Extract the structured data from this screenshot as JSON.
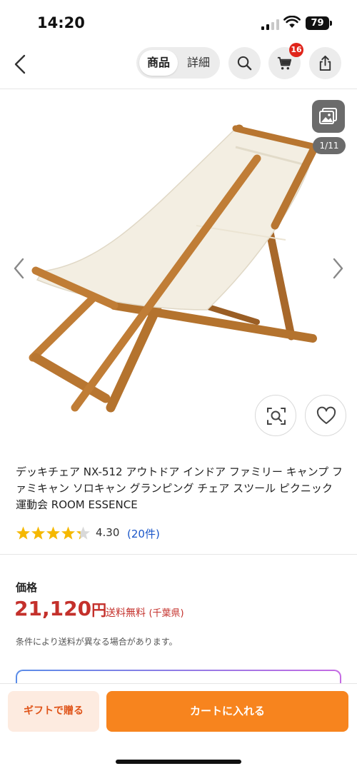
{
  "status_bar": {
    "time": "14:20",
    "battery": "79"
  },
  "nav": {
    "tab_product": "商品",
    "tab_detail": "詳細",
    "cart_badge": "16",
    "icons": [
      "back-icon",
      "search-icon",
      "cart-icon",
      "share-icon"
    ]
  },
  "gallery": {
    "counter": "1/11",
    "icons": [
      "gallery-icon",
      "arrow-left-icon",
      "arrow-right-icon",
      "image-search-icon",
      "heart-icon"
    ]
  },
  "product": {
    "title": "デッキチェア NX-512 アウトドア インドア ファミリー キャンプ ファミキャン ソロキャン グランピング チェア スツール ピクニック 運動会 ROOM ESSENCE",
    "rating_value": "4.30",
    "rating_count": "(20件)",
    "rating_stars": 4.3
  },
  "price": {
    "label": "価格",
    "amount": "21,120",
    "currency": "円",
    "shipping": "送料無料",
    "origin": "(千葉県)",
    "note": "条件により送料が異なる場合があります。"
  },
  "actions": {
    "gift": "ギフトで贈る",
    "add_to_cart": "カートに入れる"
  },
  "colors": {
    "price": "#c4302b",
    "cart_button": "#f7841e",
    "gift_button_bg": "#fdebe0",
    "star": "#f5b800",
    "link": "#1a56c9",
    "badge": "#e0241a"
  }
}
